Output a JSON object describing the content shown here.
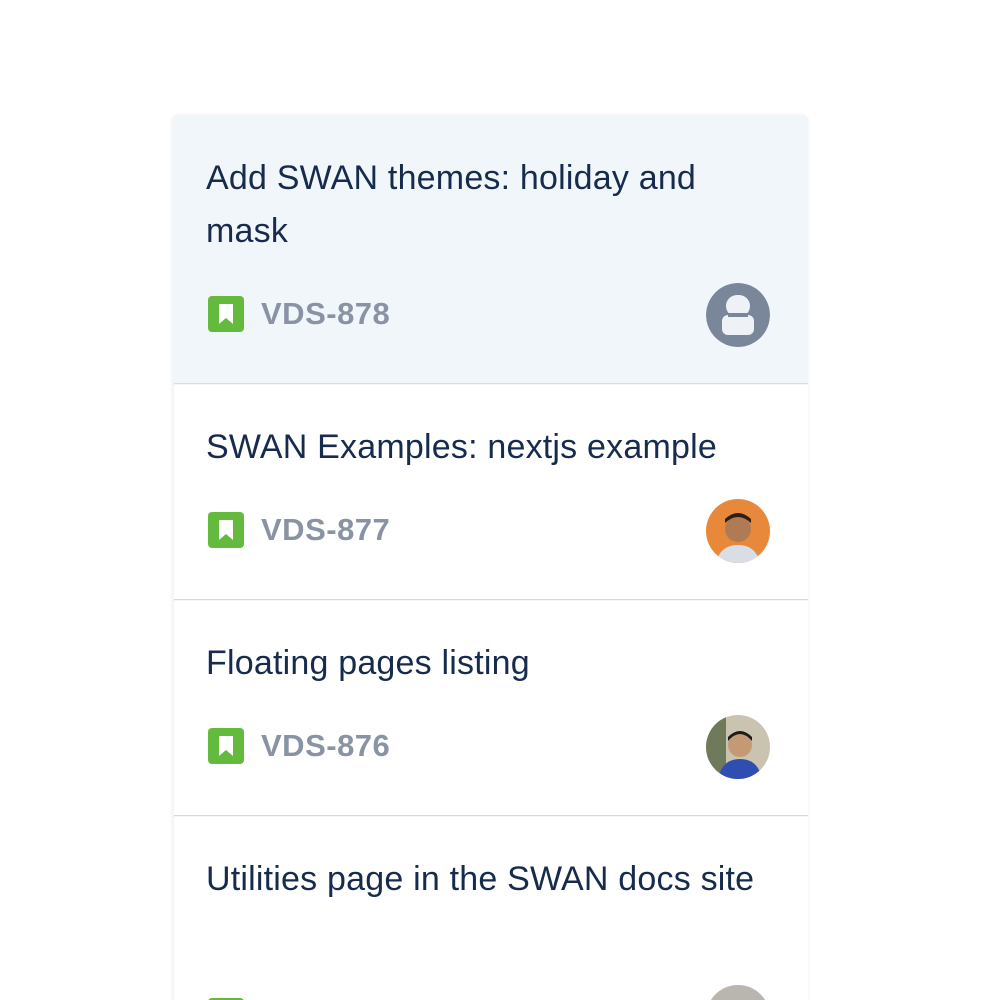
{
  "board": {
    "cards": [
      {
        "title": "Add SWAN themes: holiday and mask",
        "issue_key": "VDS-878",
        "issue_type_icon": "story-icon",
        "assignee_avatar": "default-user-avatar",
        "selected": true
      },
      {
        "title": "SWAN Examples: nextjs example",
        "issue_key": "VDS-877",
        "issue_type_icon": "story-icon",
        "assignee_avatar": "user-photo-avatar"
      },
      {
        "title": "Floating pages listing",
        "issue_key": "VDS-876",
        "issue_type_icon": "story-icon",
        "assignee_avatar": "user-photo-avatar"
      },
      {
        "title": "Utilities page in the SWAN docs site",
        "issue_key": "",
        "issue_type_icon": "story-icon",
        "assignee_avatar": "user-photo-avatar"
      }
    ]
  },
  "colors": {
    "story_icon": "#63ba3c",
    "title_text": "#172b4d",
    "issue_key_text": "#8993a4",
    "selected_card_bg": "#f1f6fb"
  }
}
